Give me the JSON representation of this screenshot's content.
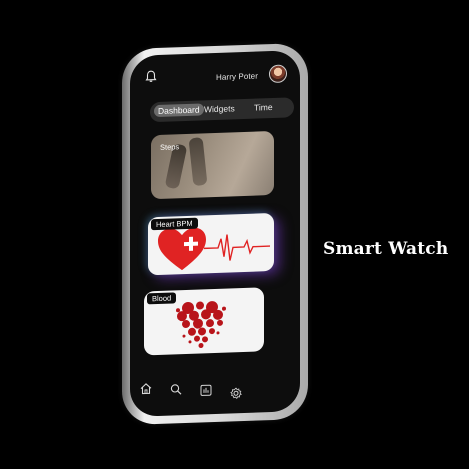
{
  "header": {
    "user_name": "Harry Poter"
  },
  "tabs": [
    {
      "label": "Dashboard",
      "active": true
    },
    {
      "label": "Widgets",
      "active": false
    },
    {
      "label": "Time",
      "active": false
    }
  ],
  "cards": {
    "steps": {
      "label": "Steps"
    },
    "heart": {
      "label": "Heart BPM"
    },
    "blood": {
      "label": "Blood"
    }
  },
  "bottom_nav": [
    {
      "icon": "home-icon"
    },
    {
      "icon": "search-icon"
    },
    {
      "icon": "chart-icon"
    },
    {
      "icon": "settings-icon"
    }
  ],
  "title": "Smart Watch",
  "colors": {
    "background": "#000000",
    "screen": "#0d0d0d",
    "heart_red": "#e02323",
    "card_white": "#f4f4f4"
  }
}
